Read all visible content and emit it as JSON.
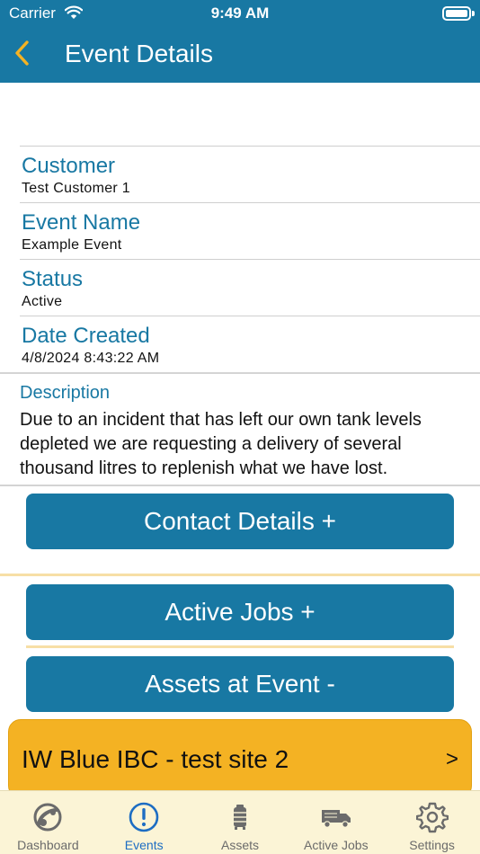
{
  "status_bar": {
    "carrier": "Carrier",
    "time": "9:49 AM"
  },
  "header": {
    "title": "Event Details",
    "back_icon": "chevron-left-icon"
  },
  "fields": [
    {
      "label": "Customer",
      "value": "Test Customer 1"
    },
    {
      "label": "Event Name",
      "value": "Example Event"
    },
    {
      "label": "Status",
      "value": "Active"
    },
    {
      "label": "Date Created",
      "value": "4/8/2024 8:43:22 AM"
    }
  ],
  "description": {
    "label": "Description",
    "text": "Due to an incident that has left our own tank levels depleted we are requesting a delivery of several thousand litres to replenish what we have lost."
  },
  "sections": {
    "contact_details": "Contact Details +",
    "active_jobs": "Active Jobs +",
    "assets_at_event": "Assets at Event -"
  },
  "assets": [
    {
      "name": "IW Blue IBC - test site 2",
      "chevron": ">"
    }
  ],
  "tabs": [
    {
      "label": "Dashboard",
      "icon": "dashboard-icon"
    },
    {
      "label": "Events",
      "icon": "alert-circle-icon",
      "active": true
    },
    {
      "label": "Assets",
      "icon": "tank-icon"
    },
    {
      "label": "Active Jobs",
      "icon": "truck-icon"
    },
    {
      "label": "Settings",
      "icon": "gear-icon"
    }
  ],
  "colors": {
    "primary": "#1878a3",
    "accent": "#f4b223",
    "tab_bar": "#fbf4d6",
    "tab_active": "#1d6dc3",
    "back_chevron": "#f4b223"
  }
}
